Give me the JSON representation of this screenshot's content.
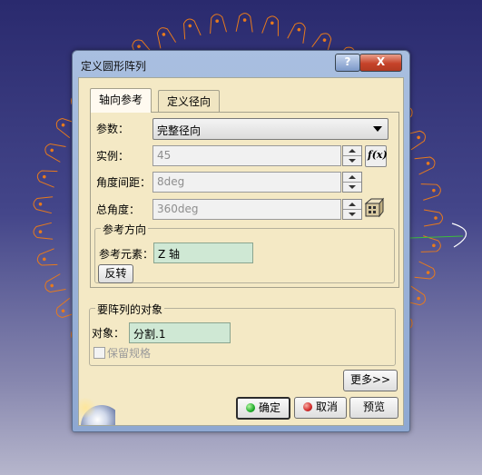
{
  "dialog": {
    "title": "定义圆形阵列",
    "help_label": "?",
    "close_label": "X"
  },
  "tabs": [
    {
      "label": "轴向参考"
    },
    {
      "label": "定义径向"
    }
  ],
  "params": {
    "label": "参数：",
    "selected": "完整径向"
  },
  "instances": {
    "label": "实例：",
    "value": "45",
    "fx_label": "f(x)"
  },
  "angular_spacing": {
    "label": "角度间距：",
    "value": "8deg"
  },
  "total_angle": {
    "label": "总角度：",
    "value": "360deg"
  },
  "ref_direction": {
    "group_title": "参考方向",
    "element_label": "参考元素：",
    "element_value": "Z 轴",
    "reverse_label": "反转"
  },
  "objects": {
    "group_title": "要阵列的对象",
    "object_label": "对象：",
    "object_value": "分割.1",
    "keep_spec_label": "保留规格"
  },
  "buttons": {
    "more": "更多>>",
    "ok": "确定",
    "cancel": "取消",
    "preview": "预览"
  },
  "colors": {
    "pattern_orange": "#e87a1c",
    "ok_dot": "#1fae2a",
    "cancel_dot": "#d22a2a"
  }
}
